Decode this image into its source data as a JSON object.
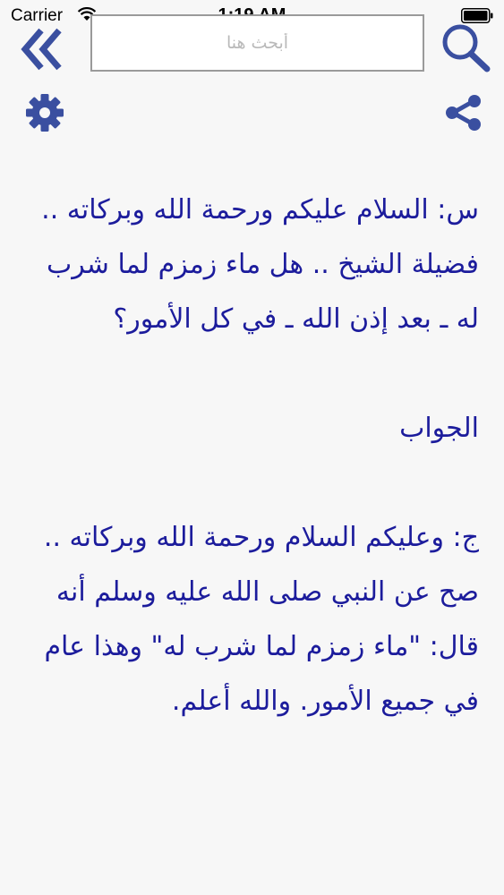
{
  "status_bar": {
    "carrier": "Carrier",
    "time": "1:19 AM"
  },
  "search": {
    "placeholder": "أبحث هنا"
  },
  "icons": {
    "back": "double-chevron-left-icon",
    "search": "magnifier-icon",
    "settings": "gear-icon",
    "share": "share-icon"
  },
  "colors": {
    "accent": "#1c1c9c",
    "icon": "#3a4fa0",
    "background": "#f7f7f7"
  },
  "content": {
    "question": "س: السلام عليكم ورحمة الله وبركاته .. فضيلة الشيخ .. هل ماء زمزم لما شرب له ـ بعد إذن الله ـ في كل الأمور؟",
    "answer_heading": "الجواب",
    "answer": "ج: وعليكم السلام ورحمة الله وبركاته .. صح عن النبي صلى الله عليه وسلم أنه قال: \"ماء زمزم لما شرب له\" وهذا عام في جميع الأمور. والله أعلم."
  }
}
